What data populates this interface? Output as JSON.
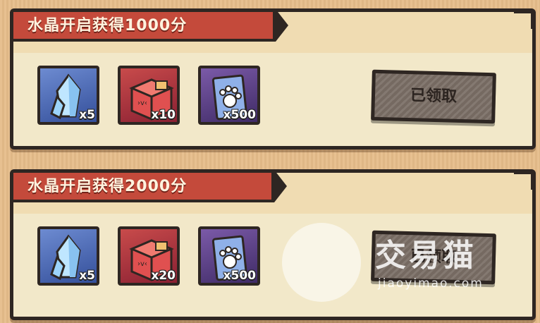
{
  "rewards": [
    {
      "title": "水晶开启获得1000分",
      "items": [
        {
          "icon": "crystal-icon",
          "qty": "x5"
        },
        {
          "icon": "red-box-icon",
          "qty": "x10"
        },
        {
          "icon": "paw-card-icon",
          "qty": "x500"
        }
      ],
      "button_label": "已领取"
    },
    {
      "title": "水晶开启获得2000分",
      "items": [
        {
          "icon": "crystal-icon",
          "qty": "x5"
        },
        {
          "icon": "red-box-icon",
          "qty": "x20"
        },
        {
          "icon": "paw-card-icon",
          "qty": "x500"
        }
      ],
      "button_label": "已领取"
    }
  ],
  "watermark": {
    "brand": "交易猫",
    "url": "jiaoyimao.com"
  },
  "colors": {
    "banner": "#c44a3b",
    "card": "#f2e8c9",
    "button": "#7b6f66",
    "background": "#e6bd8a"
  }
}
